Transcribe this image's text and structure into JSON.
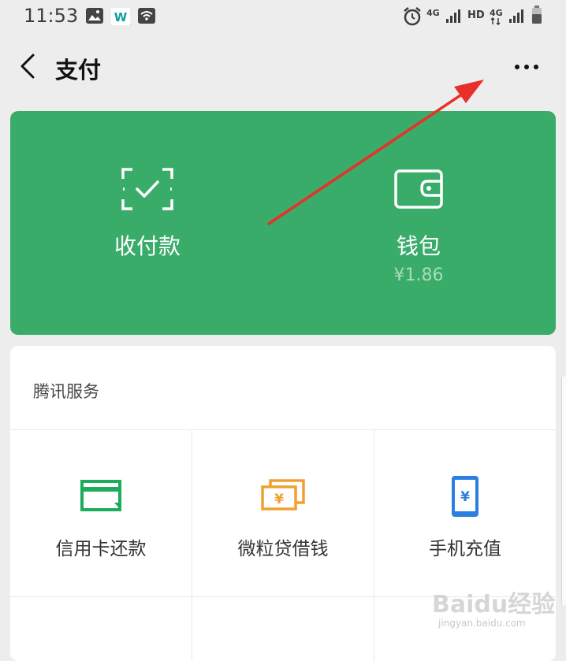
{
  "status_bar": {
    "time": "11:53",
    "network_1": "4G",
    "hd": "HD",
    "network_2": "4G",
    "icons": [
      "image-icon",
      "wps-app-icon",
      "wifi-icon",
      "alarm-icon",
      "signal-icon",
      "signal-icon",
      "battery-icon"
    ]
  },
  "nav": {
    "title": "支付",
    "back_icon": "chevron-left-icon",
    "more_icon": "more-dots-icon"
  },
  "green_card": {
    "collect_label": "收付款",
    "collect_icon": "scan-check-icon",
    "wallet_label": "钱包",
    "wallet_icon": "wallet-icon",
    "wallet_amount": "¥1.86",
    "color": "#3aac6a"
  },
  "services": {
    "title": "腾讯服务",
    "items": [
      {
        "label": "信用卡还款",
        "icon": "credit-card-icon",
        "color": "#1aad5a"
      },
      {
        "label": "微粒贷借钱",
        "icon": "cash-yuan-icon",
        "color": "#f0a030"
      },
      {
        "label": "手机充值",
        "icon": "phone-yuan-icon",
        "color": "#2b7fe0"
      }
    ]
  },
  "annotation": {
    "type": "red-arrow",
    "color": "#e8302a"
  },
  "watermark": {
    "text": "Baidu经验",
    "sub": "jingyan.baidu.com"
  }
}
